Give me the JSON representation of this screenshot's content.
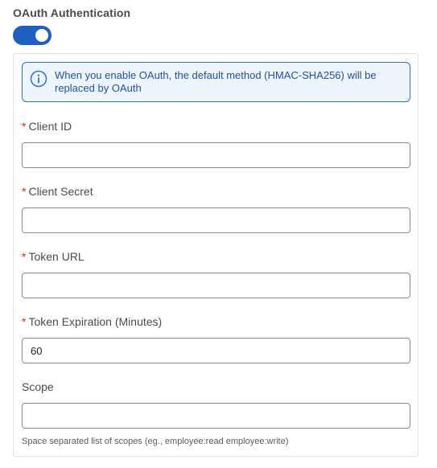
{
  "oauth": {
    "title": "OAuth Authentication",
    "enabled": true
  },
  "info": {
    "icon": "info-circle-icon",
    "message": "When you enable OAuth, the default method (HMAC-SHA256) will be replaced by OAuth",
    "accent_color": "#2f6fcf"
  },
  "fields": {
    "client_id": {
      "label": "Client ID",
      "required_mark": "*",
      "value": ""
    },
    "client_secret": {
      "label": "Client Secret",
      "required_mark": "*",
      "value": ""
    },
    "token_url": {
      "label": "Token URL",
      "required_mark": "*",
      "value": ""
    },
    "token_expiration": {
      "label": "Token Expiration (Minutes)",
      "required_mark": "*",
      "value": "60"
    },
    "scope": {
      "label": "Scope",
      "value": "",
      "helper": "Space separated list of scopes (eg., employee:read employee:write)"
    }
  },
  "colors": {
    "toggle_on": "#1f5fc4",
    "required": "#d93025"
  }
}
